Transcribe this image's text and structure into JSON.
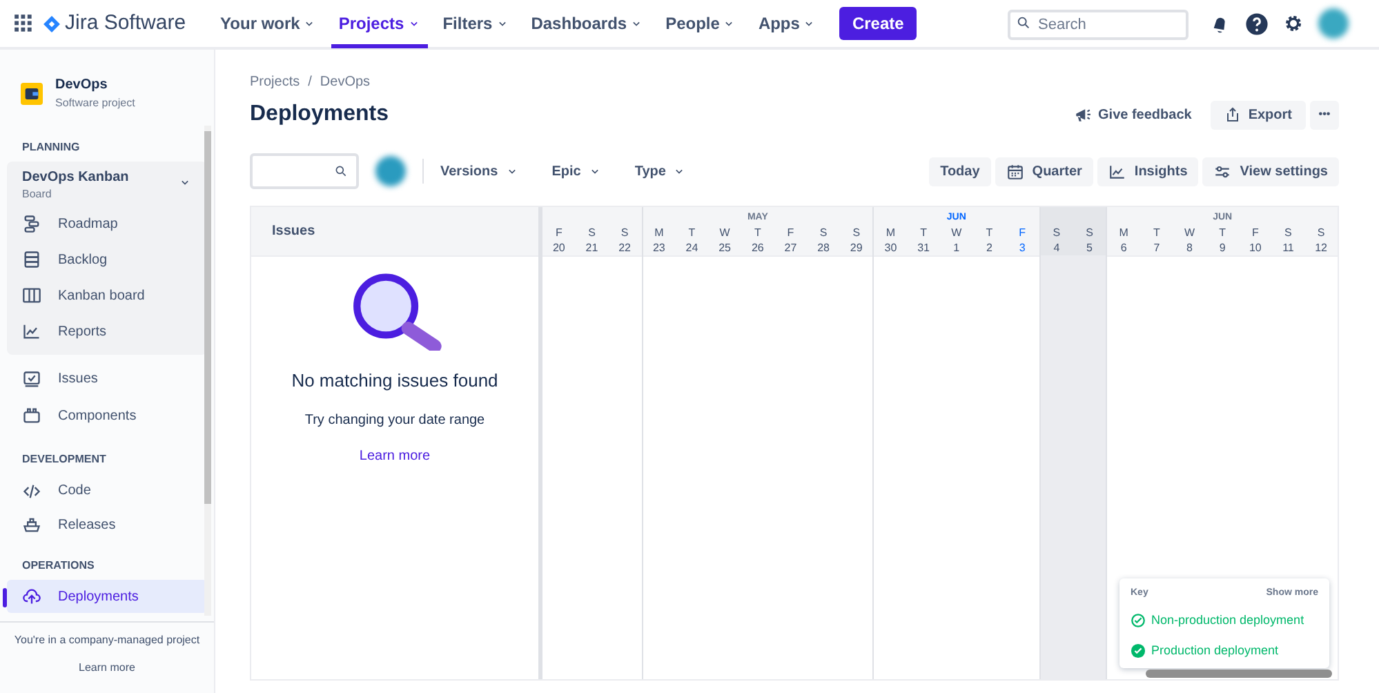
{
  "topbar": {
    "product": "Jira Software",
    "nav": [
      {
        "label": "Your work",
        "selected": false
      },
      {
        "label": "Projects",
        "selected": true
      },
      {
        "label": "Filters",
        "selected": false
      },
      {
        "label": "Dashboards",
        "selected": false
      },
      {
        "label": "People",
        "selected": false
      },
      {
        "label": "Apps",
        "selected": false
      }
    ],
    "create": "Create",
    "search": {
      "placeholder": "Search"
    }
  },
  "sidebar": {
    "project": {
      "name": "DevOps",
      "type": "Software project"
    },
    "sections": [
      {
        "heading": "PLANNING",
        "board": {
          "name": "DevOps Kanban",
          "type": "Board",
          "expanded": true
        },
        "items": [
          {
            "label": "Roadmap",
            "selected": false
          },
          {
            "label": "Backlog",
            "selected": false
          },
          {
            "label": "Kanban board",
            "selected": false
          },
          {
            "label": "Reports",
            "selected": false
          }
        ],
        "after": [
          {
            "label": "Issues",
            "selected": false
          },
          {
            "label": "Components",
            "selected": false
          }
        ]
      },
      {
        "heading": "DEVELOPMENT",
        "items": [
          {
            "label": "Code",
            "selected": false
          },
          {
            "label": "Releases",
            "selected": false
          }
        ]
      },
      {
        "heading": "OPERATIONS",
        "items": [
          {
            "label": "Deployments",
            "selected": true
          }
        ]
      }
    ],
    "footer": {
      "text": "You're in a company-managed project",
      "link": "Learn more"
    }
  },
  "breadcrumbs": [
    "Projects",
    "DevOps"
  ],
  "breadcrumb_separator": "/",
  "title": "Deployments",
  "header_actions": {
    "feedback": "Give feedback",
    "export": "Export",
    "more": "•••"
  },
  "filters": [
    "Versions",
    "Epic",
    "Type"
  ],
  "view_buttons": [
    "Today",
    "Quarter",
    "Insights",
    "View settings"
  ],
  "timeline": {
    "issues_heading": "Issues",
    "groups": [
      {
        "shaded": false,
        "days": [
          {
            "weekday": "F",
            "date": "20",
            "today": false
          },
          {
            "weekday": "S",
            "date": "21",
            "today": false
          },
          {
            "weekday": "S",
            "date": "22",
            "today": false
          }
        ]
      },
      {
        "month": "MAY",
        "current": false,
        "shaded": false,
        "days": [
          {
            "weekday": "M",
            "date": "23",
            "today": false
          },
          {
            "weekday": "T",
            "date": "24",
            "today": false
          },
          {
            "weekday": "W",
            "date": "25",
            "today": false
          },
          {
            "weekday": "T",
            "date": "26",
            "today": false
          },
          {
            "weekday": "F",
            "date": "27",
            "today": false
          },
          {
            "weekday": "S",
            "date": "28",
            "today": false
          },
          {
            "weekday": "S",
            "date": "29",
            "today": false
          }
        ]
      },
      {
        "month": "JUN",
        "current": true,
        "shaded": false,
        "days": [
          {
            "weekday": "M",
            "date": "30",
            "today": false
          },
          {
            "weekday": "T",
            "date": "31",
            "today": false
          },
          {
            "weekday": "W",
            "date": "1",
            "today": false
          },
          {
            "weekday": "T",
            "date": "2",
            "today": false
          },
          {
            "weekday": "F",
            "date": "3",
            "today": true
          }
        ]
      },
      {
        "shaded": true,
        "days": [
          {
            "weekday": "S",
            "date": "4",
            "today": false
          },
          {
            "weekday": "S",
            "date": "5",
            "today": false
          }
        ]
      },
      {
        "month": "JUN",
        "current": false,
        "shaded": false,
        "days": [
          {
            "weekday": "M",
            "date": "6",
            "today": false
          },
          {
            "weekday": "T",
            "date": "7",
            "today": false
          },
          {
            "weekday": "W",
            "date": "8",
            "today": false
          },
          {
            "weekday": "T",
            "date": "9",
            "today": false
          },
          {
            "weekday": "F",
            "date": "10",
            "today": false
          },
          {
            "weekday": "S",
            "date": "11",
            "today": false
          },
          {
            "weekday": "S",
            "date": "12",
            "today": false
          }
        ]
      }
    ],
    "empty": {
      "title": "No matching issues found",
      "text": "Try changing your date range",
      "link": "Learn more"
    },
    "key": {
      "title": "Key",
      "action": "Show more",
      "items": [
        {
          "label": "Non-production deployment",
          "kind": "outline"
        },
        {
          "label": "Production deployment",
          "kind": "filled"
        }
      ]
    }
  }
}
